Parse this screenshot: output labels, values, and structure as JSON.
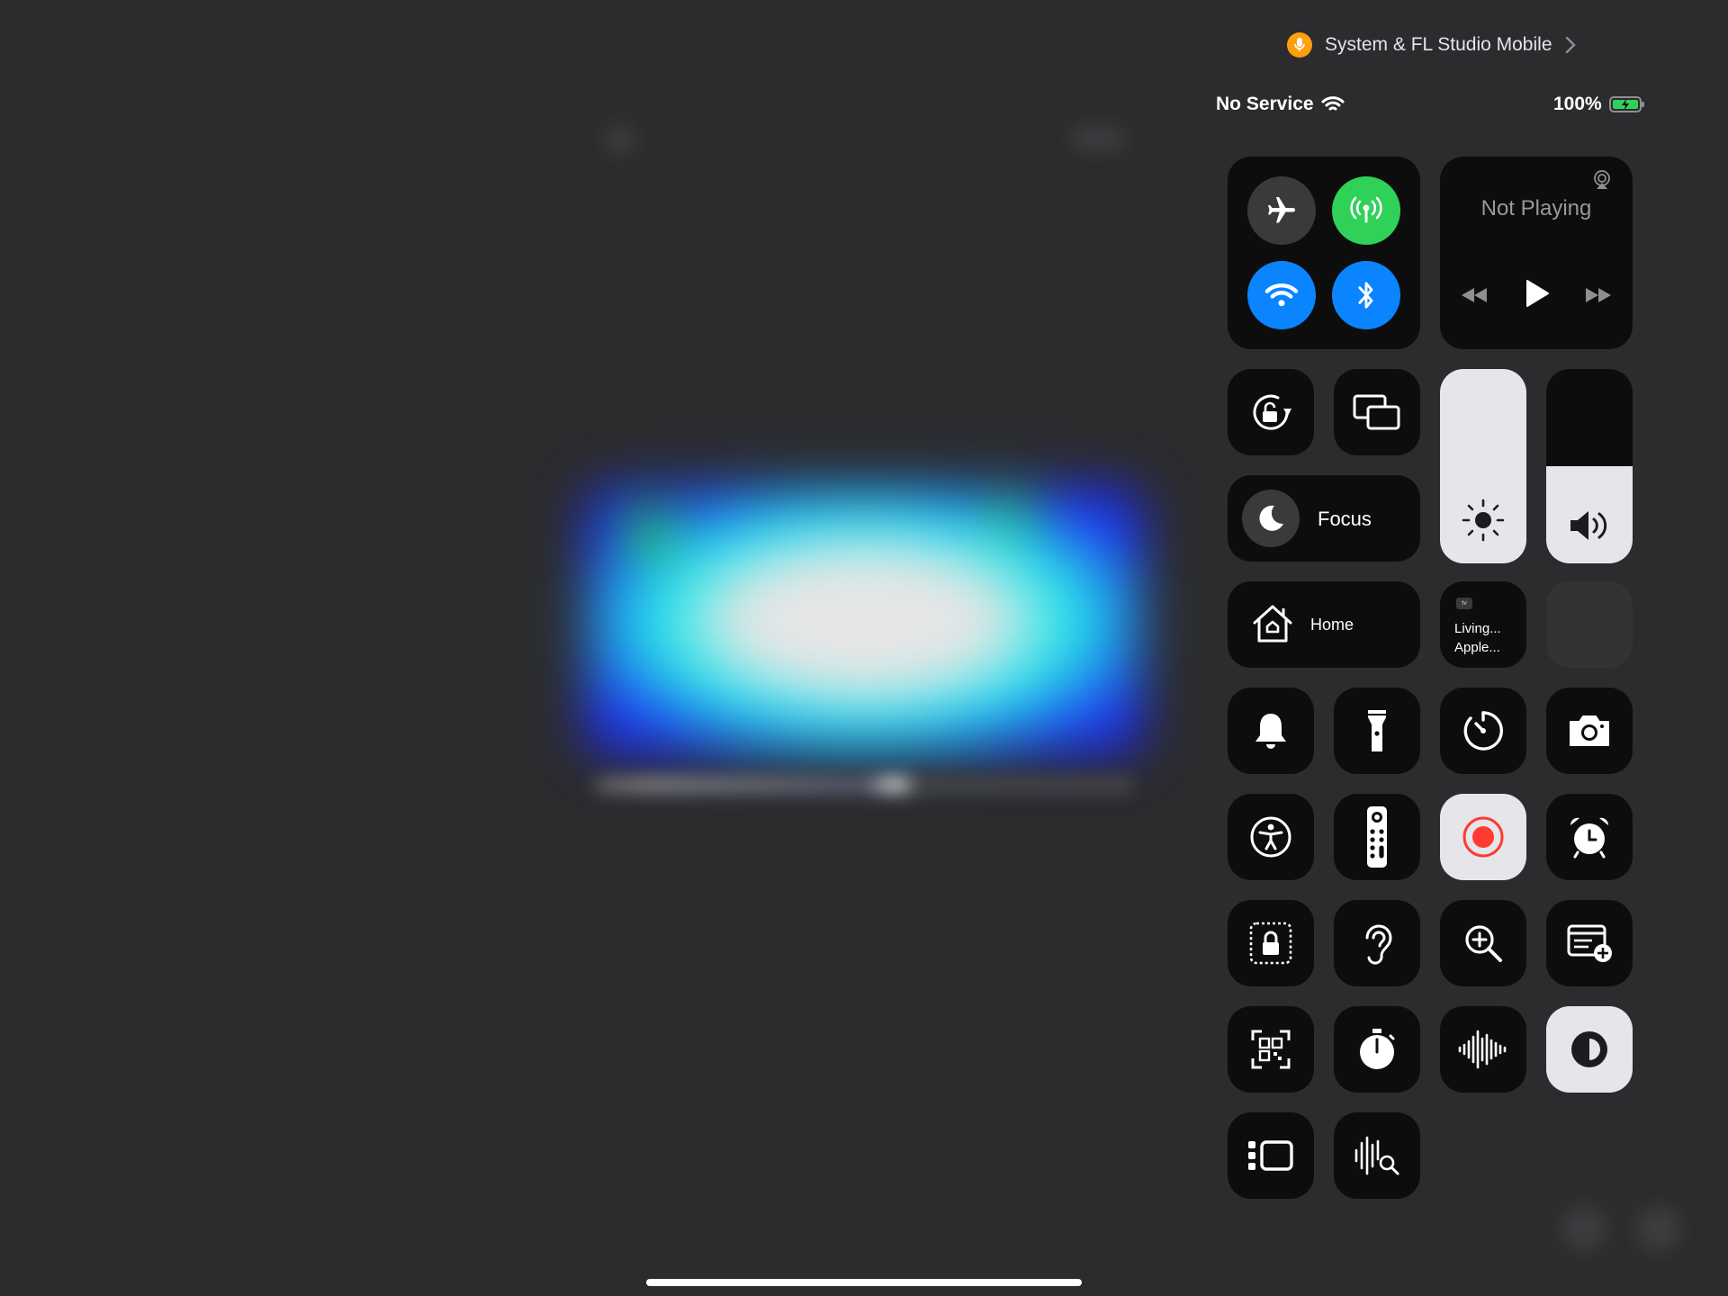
{
  "privacy_indicator": {
    "label": "System & FL Studio Mobile",
    "mic_color": "#ff9f0a"
  },
  "status_bar": {
    "carrier": "No Service",
    "battery_percent": "100%",
    "battery_level": 1.0,
    "battery_color": "#30d158"
  },
  "connectivity": {
    "airplane": {
      "icon": "airplane-icon",
      "on": false
    },
    "cellular": {
      "icon": "cellular-antenna-icon",
      "on": true,
      "color": "#30d158"
    },
    "wifi": {
      "icon": "wifi-icon",
      "on": true,
      "color": "#0a84ff"
    },
    "bluetooth": {
      "icon": "bluetooth-icon",
      "on": true,
      "color": "#0a84ff"
    }
  },
  "now_playing": {
    "title": "Not Playing",
    "airplay_icon": "airplay-icon",
    "controls": [
      "rewind-icon",
      "play-icon",
      "fast-forward-icon"
    ]
  },
  "focus": {
    "label": "Focus",
    "icon": "moon-icon"
  },
  "home": {
    "label": "Home",
    "icon": "house-icon"
  },
  "apple_tv": {
    "badge": "tv",
    "line1": "Living...",
    "line2": "Apple..."
  },
  "brightness": {
    "level": 1.0,
    "icon": "sun-icon"
  },
  "volume": {
    "level": 0.5,
    "icon": "speaker-icon"
  },
  "controls": [
    "bell-icon",
    "flashlight-icon",
    "timer-icon",
    "camera-icon",
    "accessibility-icon",
    "remote-icon",
    "screen-record-icon",
    "alarm-icon",
    "guided-access-icon",
    "hearing-icon",
    "magnifier-icon",
    "quick-note-icon",
    "qr-code-icon",
    "stopwatch-icon",
    "voice-memo-icon",
    "dark-mode-icon",
    "stage-manager-icon",
    "sound-recognition-icon"
  ],
  "record_color": "#ff3b30"
}
